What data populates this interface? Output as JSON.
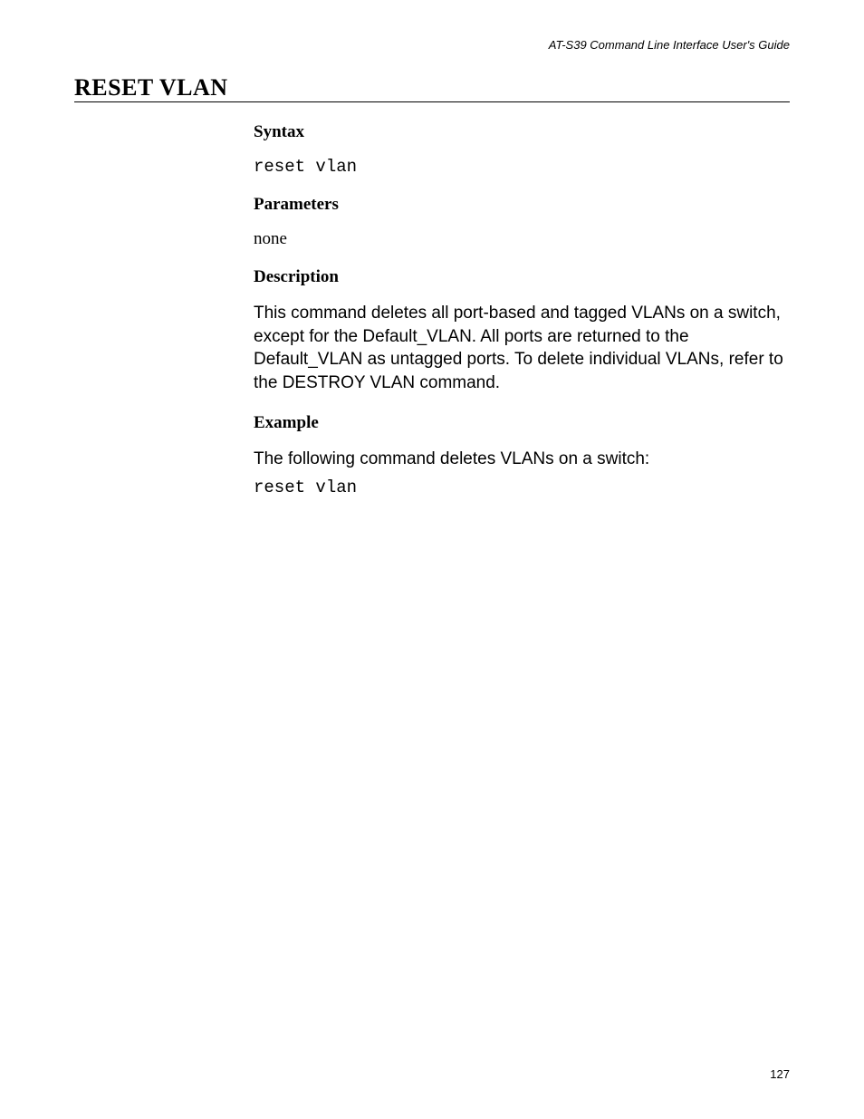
{
  "header": {
    "guide_title": "AT-S39 Command Line Interface User's Guide"
  },
  "page": {
    "title": "RESET VLAN",
    "number": "127"
  },
  "sections": {
    "syntax": {
      "heading": "Syntax",
      "code": "reset vlan"
    },
    "parameters": {
      "heading": "Parameters",
      "text": "none"
    },
    "description": {
      "heading": "Description",
      "text": "This command deletes all port-based and tagged VLANs on a switch, except for the Default_VLAN. All ports are returned to the Default_VLAN as untagged ports. To delete individual VLANs, refer to the DESTROY VLAN command."
    },
    "example": {
      "heading": "Example",
      "intro": "The following command deletes VLANs on a switch:",
      "code": "reset vlan"
    }
  }
}
